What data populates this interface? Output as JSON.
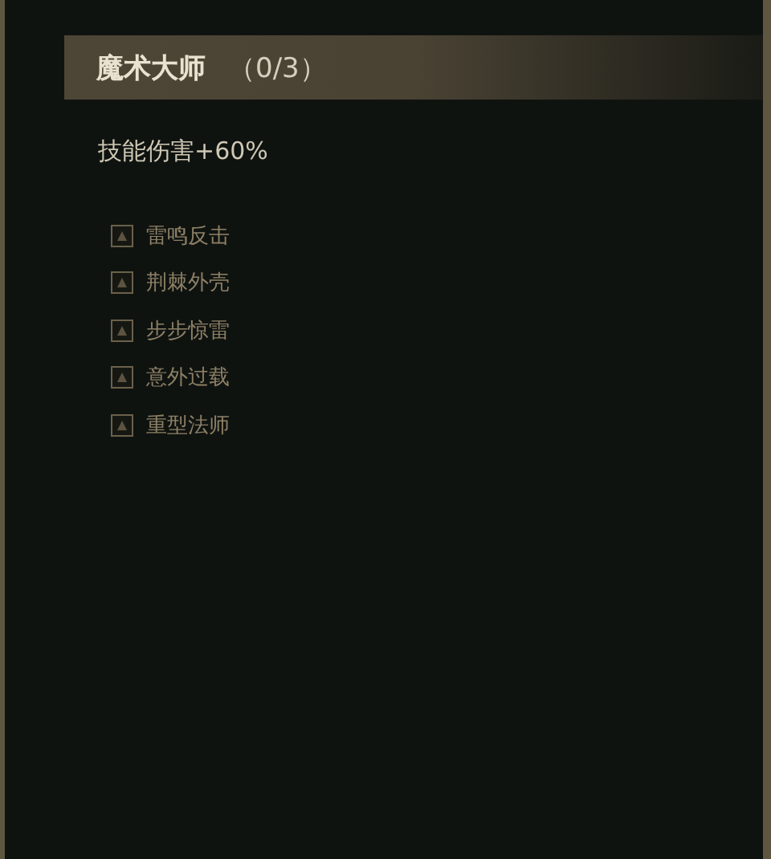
{
  "header": {
    "title": "魔术大师",
    "progress": "（0/3）"
  },
  "description": "技能伤害+60%",
  "skills": [
    {
      "name": "雷鸣反击"
    },
    {
      "name": "荆棘外壳"
    },
    {
      "name": "步步惊雷"
    },
    {
      "name": "意外过载"
    },
    {
      "name": "重型法师"
    }
  ]
}
